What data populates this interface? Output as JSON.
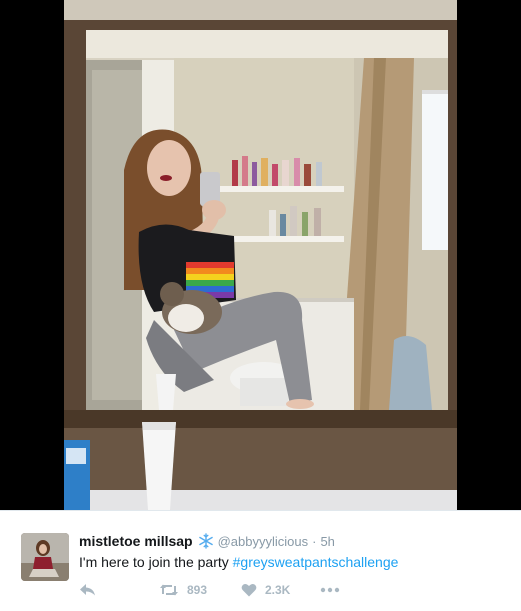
{
  "tweet": {
    "display_name": "mistletoe millsap",
    "badge_icon": "snowflake-icon",
    "handle": "@abbyyylicious",
    "separator": "·",
    "time": "5h",
    "text": "I'm here to join the party ",
    "hashtag": "#greysweatpantschallenge"
  },
  "actions": {
    "reply_icon": "reply-icon",
    "retweet_icon": "retweet-icon",
    "retweet_count": "893",
    "like_icon": "heart-icon",
    "like_count": "2.3K",
    "more_icon": "more-icon"
  },
  "colors": {
    "link": "#1da1f2",
    "name": "#14171a",
    "meta": "#8899a6",
    "action": "#aab8c2",
    "badge": "#55acee"
  }
}
